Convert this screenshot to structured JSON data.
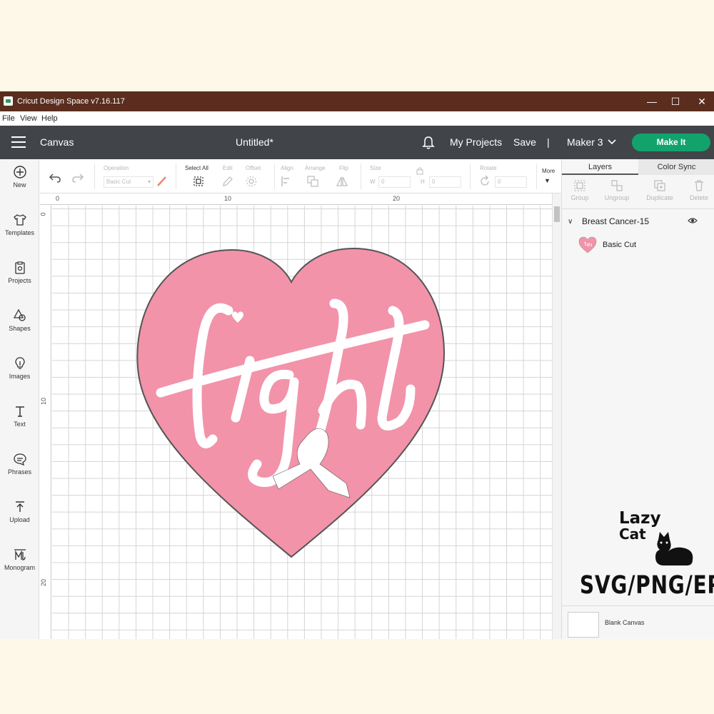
{
  "window": {
    "title": "Cricut Design Space  v7.16.117",
    "minimize": "—",
    "maximize": "☐",
    "close": "✕"
  },
  "menu": {
    "items": [
      "File",
      "View",
      "Help"
    ]
  },
  "header": {
    "section": "Canvas",
    "document_title": "Untitled*",
    "my_projects": "My Projects",
    "save": "Save",
    "divider": "|",
    "machine": "Maker 3",
    "make_it": "Make It",
    "accent_color": "#12a36d"
  },
  "leftnav": {
    "items": [
      {
        "label": "New",
        "icon": "plus-circle-icon"
      },
      {
        "label": "Templates",
        "icon": "shirt-icon"
      },
      {
        "label": "Projects",
        "icon": "clipboard-icon"
      },
      {
        "label": "Shapes",
        "icon": "shapes-icon"
      },
      {
        "label": "Images",
        "icon": "bulb-icon"
      },
      {
        "label": "Text",
        "icon": "text-icon"
      },
      {
        "label": "Phrases",
        "icon": "speech-bubble-icon"
      },
      {
        "label": "Upload",
        "icon": "upload-icon"
      },
      {
        "label": "Monogram",
        "icon": "monogram-icon"
      }
    ]
  },
  "toolbar": {
    "operation_label": "Operation",
    "operation_value": "Basic Cut",
    "select_all": "Select All",
    "edit": "Edit",
    "offset": "Offset",
    "align": "Align",
    "arrange": "Arrange",
    "flip": "Flip",
    "size": "Size",
    "w_label": "W",
    "w_value": "0",
    "h_label": "H",
    "h_value": "0",
    "rotate": "Rotate",
    "rotate_value": "0",
    "more": "More"
  },
  "ruler": {
    "top": [
      "0",
      "10",
      "20"
    ],
    "left": [
      "0",
      "10",
      "20"
    ]
  },
  "artwork": {
    "text": "fight",
    "fill_color": "#f293a9",
    "outline_color": "#333333"
  },
  "rightpanel": {
    "tabs": [
      "Layers",
      "Color Sync"
    ],
    "actions": [
      "Group",
      "Ungroup",
      "Duplicate",
      "Delete"
    ],
    "layer_group": "Breast Cancer-15",
    "layer_item": "Basic Cut",
    "blank_canvas": "Blank Canvas"
  },
  "branding": {
    "line1": "Lazy",
    "line2": "Cat",
    "formats": "SVG/PNG/EPS"
  }
}
